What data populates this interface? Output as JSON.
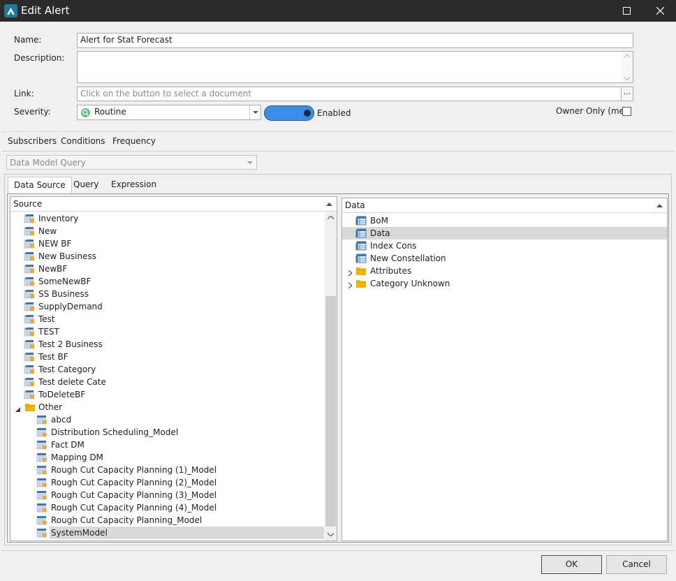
{
  "window": {
    "title": "Edit Alert"
  },
  "form": {
    "name_label": "Name:",
    "name_value": "Alert for Stat Forecast",
    "description_label": "Description:",
    "description_value": "",
    "link_label": "Link:",
    "link_placeholder": "Click on the button to select a document",
    "link_button": "...",
    "severity_label": "Severity:",
    "severity_value": "Routine",
    "toggle_label": "Enabled",
    "owner_only_label": "Owner Only (me)"
  },
  "tabs": {
    "subscribers": "Subscribers",
    "conditions": "Conditions",
    "frequency": "Frequency"
  },
  "query_type": {
    "value": "Data Model Query"
  },
  "inner_tabs": {
    "data_source": "Data Source",
    "query": "Query",
    "expression": "Expression"
  },
  "source_pane": {
    "header": "Source",
    "items": [
      {
        "label": "Inventory",
        "level": 1,
        "kind": "cube"
      },
      {
        "label": "New",
        "level": 1,
        "kind": "cube"
      },
      {
        "label": "NEW BF",
        "level": 1,
        "kind": "cube"
      },
      {
        "label": "New Business",
        "level": 1,
        "kind": "cube"
      },
      {
        "label": "NewBF",
        "level": 1,
        "kind": "cube"
      },
      {
        "label": "SomeNewBF",
        "level": 1,
        "kind": "cube"
      },
      {
        "label": "SS Business",
        "level": 1,
        "kind": "cube"
      },
      {
        "label": "SupplyDemand",
        "level": 1,
        "kind": "cube"
      },
      {
        "label": "Test",
        "level": 1,
        "kind": "cube"
      },
      {
        "label": "TEST",
        "level": 1,
        "kind": "cube"
      },
      {
        "label": "Test 2 Business",
        "level": 1,
        "kind": "cube"
      },
      {
        "label": "Test BF",
        "level": 1,
        "kind": "cube"
      },
      {
        "label": "Test Category",
        "level": 1,
        "kind": "cube"
      },
      {
        "label": "Test delete Cate",
        "level": 1,
        "kind": "cube"
      },
      {
        "label": "ToDeleteBF",
        "level": 1,
        "kind": "cube"
      },
      {
        "label": "Other",
        "level": 0,
        "kind": "folder"
      },
      {
        "label": "abcd",
        "level": 2,
        "kind": "model"
      },
      {
        "label": "Distribution Scheduling_Model",
        "level": 2,
        "kind": "model"
      },
      {
        "label": "Fact DM",
        "level": 2,
        "kind": "model"
      },
      {
        "label": "Mapping DM",
        "level": 2,
        "kind": "model"
      },
      {
        "label": "Rough Cut Capacity Planning (1)_Model",
        "level": 2,
        "kind": "model"
      },
      {
        "label": "Rough Cut Capacity Planning (2)_Model",
        "level": 2,
        "kind": "model"
      },
      {
        "label": "Rough Cut Capacity Planning (3)_Model",
        "level": 2,
        "kind": "model"
      },
      {
        "label": "Rough Cut Capacity Planning (4)_Model",
        "level": 2,
        "kind": "model"
      },
      {
        "label": "Rough Cut Capacity Planning_Model",
        "level": 2,
        "kind": "model"
      },
      {
        "label": "SystemModel",
        "level": 2,
        "kind": "model",
        "selected": true
      }
    ]
  },
  "data_pane": {
    "header": "Data",
    "items": [
      {
        "label": "BoM",
        "kind": "table"
      },
      {
        "label": "Data",
        "kind": "table",
        "selected": true
      },
      {
        "label": "Index Cons",
        "kind": "table"
      },
      {
        "label": "New Constellation",
        "kind": "table"
      },
      {
        "label": "Attributes",
        "kind": "folder"
      },
      {
        "label": "Category Unknown",
        "kind": "folder"
      }
    ]
  },
  "buttons": {
    "ok": "OK",
    "cancel": "Cancel"
  },
  "colors": {
    "title_bar": "#2b2b2b",
    "toggle": "#3d8eea",
    "folder": "#f5b400",
    "selection": "#d9d9d9"
  }
}
